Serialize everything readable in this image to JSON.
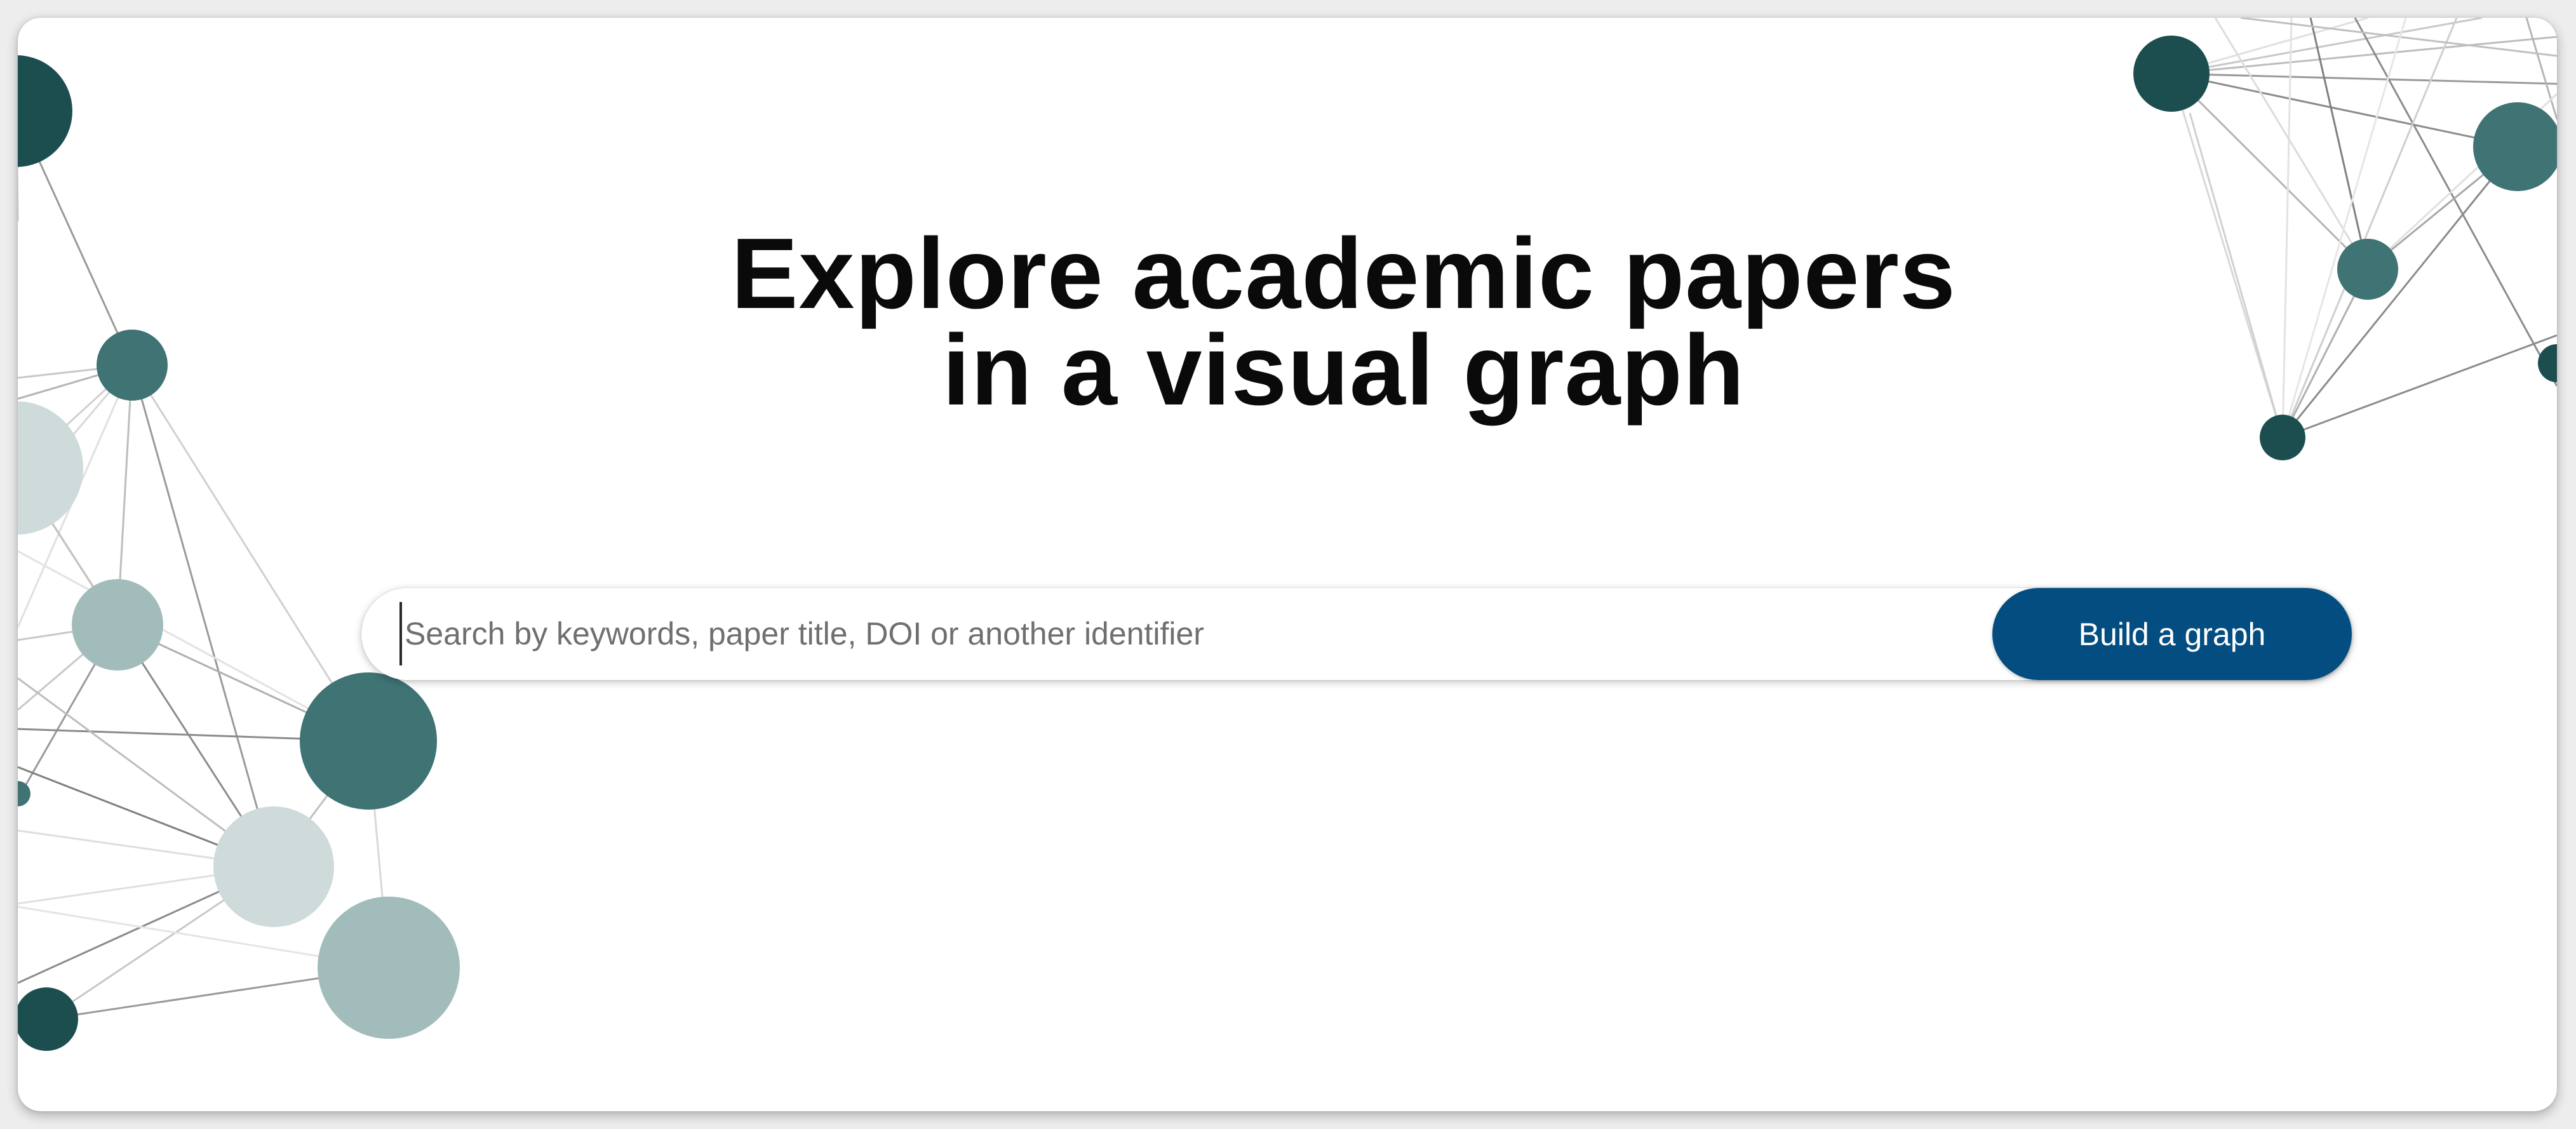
{
  "hero": {
    "title_line1": "Explore academic papers",
    "title_line2": "in a visual graph"
  },
  "search": {
    "placeholder": "Search by keywords, paper title, DOI or another identifier",
    "value": "",
    "button_label": "Build a graph"
  },
  "colors": {
    "button_accent": "#044d80",
    "node_dark": "#1d4e4f",
    "node_mid": "#3f7374",
    "node_light": "#a2bcbc"
  }
}
